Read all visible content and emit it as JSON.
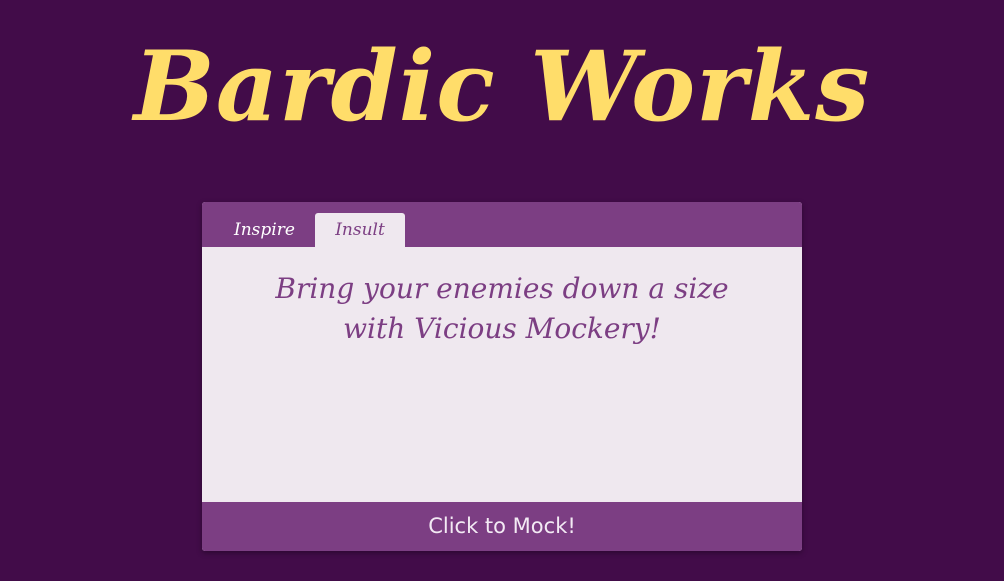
{
  "app": {
    "title": "Bardic Works"
  },
  "tabs": [
    {
      "label": "Inspire",
      "active": false
    },
    {
      "label": "Insult",
      "active": true
    }
  ],
  "content": {
    "message": "Bring your enemies down a size with Vicious Mockery!"
  },
  "action": {
    "label": "Click to Mock!"
  },
  "colors": {
    "background": "#420c49",
    "title": "#ffdd6a",
    "accent": "#7c3e83",
    "panel": "#efe8ef"
  }
}
